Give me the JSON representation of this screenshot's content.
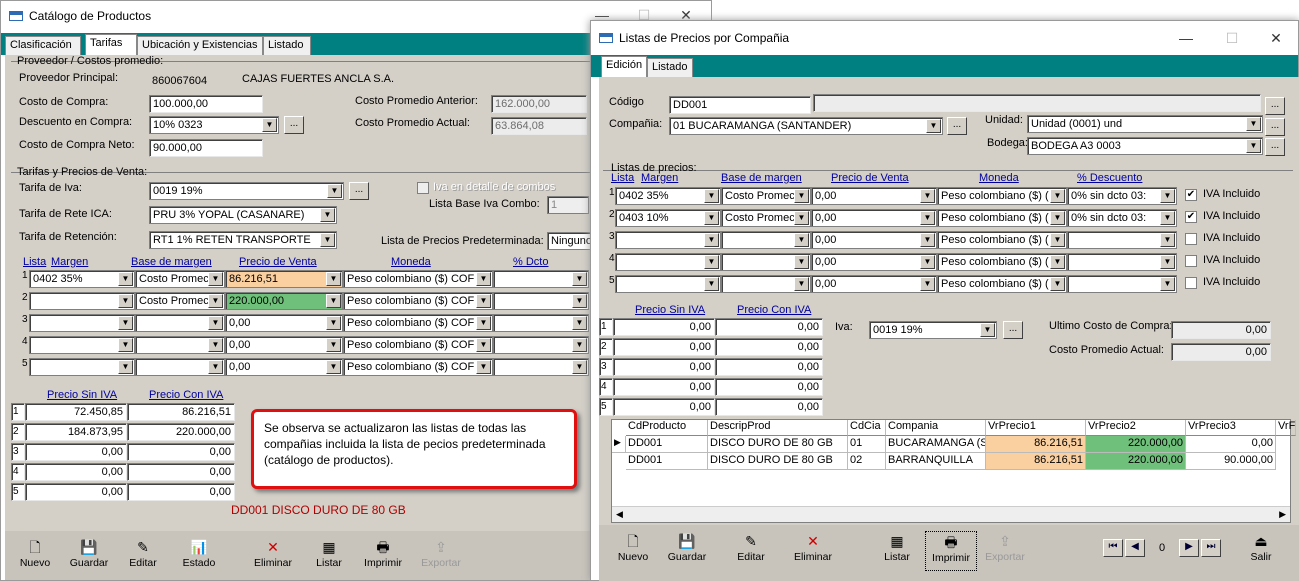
{
  "catalog": {
    "title": "Catálogo de Productos",
    "tabs": [
      "Clasificación",
      "Tarifas",
      "Ubicación y Existencias",
      "Listado"
    ],
    "proveedor_group": "Proveedor / Costos promedio:",
    "proveedor_label": "Proveedor Principal:",
    "proveedor_code": "860067604",
    "proveedor_name": "CAJAS FUERTES ANCLA S.A.",
    "costo_compra_label": "Costo de Compra:",
    "costo_compra": "100.000,00",
    "descuento_label": "Descuento en Compra:",
    "descuento": "10% 0323",
    "costo_neto_label": "Costo de Compra Neto:",
    "costo_neto": "90.000,00",
    "costo_prom_ant_label": "Costo Promedio Anterior:",
    "costo_prom_ant": "162.000,00",
    "costo_prom_act_label": "Costo Promedio Actual:",
    "costo_prom_act": "63.864,08",
    "tarifas_group": "Tarifas y Precios de Venta:",
    "iva_label": "Tarifa de Iva:",
    "iva": "0019 19%",
    "rete_ica_label": "Tarifa de Rete ICA:",
    "rete_ica": "PRU  3% YOPAL (CASANARE)",
    "retencion_label": "Tarifa de Retención:",
    "retencion": "RT1  1% RETEN TRANSPORTE",
    "iva_combos_label": "Iva en detalle de combos",
    "lista_base_label": "Lista Base Iva Combo:",
    "lista_base": "1",
    "lista_pred_label": "Lista de Precios Predeterminada:",
    "lista_pred": "Ninguno",
    "cols": [
      "Lista",
      "Margen",
      "Base de margen",
      "Precio de Venta",
      "Moneda",
      "% Dcto"
    ],
    "rows": [
      {
        "num": "1",
        "lista": "0402 35%",
        "base": "Costo Promec",
        "precio": "86.216,51",
        "moneda": "Peso colombiano ($) COF"
      },
      {
        "num": "2",
        "lista": "",
        "base": "Costo Promec",
        "precio": "220.000,00",
        "moneda": "Peso colombiano ($) COF"
      },
      {
        "num": "3",
        "lista": "",
        "base": "",
        "precio": "0,00",
        "moneda": "Peso colombiano ($) COF"
      },
      {
        "num": "4",
        "lista": "",
        "base": "",
        "precio": "0,00",
        "moneda": "Peso colombiano ($) COF"
      },
      {
        "num": "5",
        "lista": "",
        "base": "",
        "precio": "0,00",
        "moneda": "Peso colombiano ($) COF"
      }
    ],
    "sub_cols": [
      "Precio Sin IVA",
      "Precio Con IVA"
    ],
    "sub_rows": [
      [
        "1",
        "72.450,85",
        "86.216,51"
      ],
      [
        "2",
        "184.873,95",
        "220.000,00"
      ],
      [
        "3",
        "0,00",
        "0,00"
      ],
      [
        "4",
        "0,00",
        "0,00"
      ],
      [
        "5",
        "0,00",
        "0,00"
      ]
    ],
    "product": "DD001 DISCO DURO DE 80 GB",
    "callout": "Se observa se actualizaron las listas de todas las compañias incluida la lista de pecios predeterminada (catálogo de productos).",
    "toolbar": [
      "Nuevo",
      "Guardar",
      "Editar",
      "Estado",
      "Eliminar",
      "Listar",
      "Imprimir",
      "Exportar"
    ]
  },
  "listas": {
    "title": "Listas de Precios por Compañia",
    "tabs": [
      "Edición",
      "Listado"
    ],
    "codigo_label": "Código",
    "codigo": "DD001",
    "compania_label": "Compañia:",
    "compania": "01  BUCARAMANGA  (SANTANDER)",
    "unidad_label": "Unidad:",
    "unidad": "Unidad (0001) und",
    "bodega_label": "Bodega:",
    "bodega": "BODEGA A3 0003",
    "listas_group": "Listas de precios:",
    "cols": [
      "Lista",
      "Margen",
      "Base de margen",
      "Precio de Venta",
      "Moneda",
      "% Descuento"
    ],
    "iva_incluido": "IVA Incluido",
    "rows": [
      {
        "num": "1",
        "lista": "0402 35%",
        "base": "Costo Promec",
        "precio": "0,00",
        "moneda": "Peso colombiano ($) (",
        "dcto": "0% sin dcto 03:",
        "iva": true
      },
      {
        "num": "2",
        "lista": "0403 10%",
        "base": "Costo Promec",
        "precio": "0,00",
        "moneda": "Peso colombiano ($) (",
        "dcto": "0% sin dcto 03:",
        "iva": true
      },
      {
        "num": "3",
        "lista": "",
        "base": "",
        "precio": "0,00",
        "moneda": "Peso colombiano ($) (",
        "dcto": "",
        "iva": false
      },
      {
        "num": "4",
        "lista": "",
        "base": "",
        "precio": "0,00",
        "moneda": "Peso colombiano ($) (",
        "dcto": "",
        "iva": false
      },
      {
        "num": "5",
        "lista": "",
        "base": "",
        "precio": "0,00",
        "moneda": "Peso colombiano ($) (",
        "dcto": "",
        "iva": false
      }
    ],
    "sub_cols": [
      "Precio Sin IVA",
      "Precio Con IVA"
    ],
    "sub_rows": [
      [
        "1",
        "0,00",
        "0,00"
      ],
      [
        "2",
        "0,00",
        "0,00"
      ],
      [
        "3",
        "0,00",
        "0,00"
      ],
      [
        "4",
        "0,00",
        "0,00"
      ],
      [
        "5",
        "0,00",
        "0,00"
      ]
    ],
    "iva_label": "Iva:",
    "iva": "0019 19%",
    "ultimo_costo_label": "Ultimo Costo de Compra:",
    "ultimo_costo": "0,00",
    "costo_prom_label": "Costo Promedio Actual:",
    "costo_prom": "0,00",
    "grid_cols": [
      "CdProducto",
      "DescripProd",
      "CdCia",
      "Compania",
      "VrPrecio1",
      "VrPrecio2",
      "VrPrecio3",
      "VrF"
    ],
    "grid_rows": [
      [
        "DD001",
        "DISCO DURO DE 80 GB",
        "01",
        "BUCARAMANGA  (SA",
        "86.216,51",
        "220.000,00",
        "0,00"
      ],
      [
        "DD001",
        "DISCO DURO DE 80 GB",
        "02",
        "BARRANQUILLA",
        "86.216,51",
        "220.000,00",
        "90.000,00"
      ]
    ],
    "toolbar": [
      "Nuevo",
      "Guardar",
      "Editar",
      "Eliminar",
      "Listar",
      "Imprimir",
      "Exportar",
      "Salir"
    ],
    "record": "0"
  }
}
